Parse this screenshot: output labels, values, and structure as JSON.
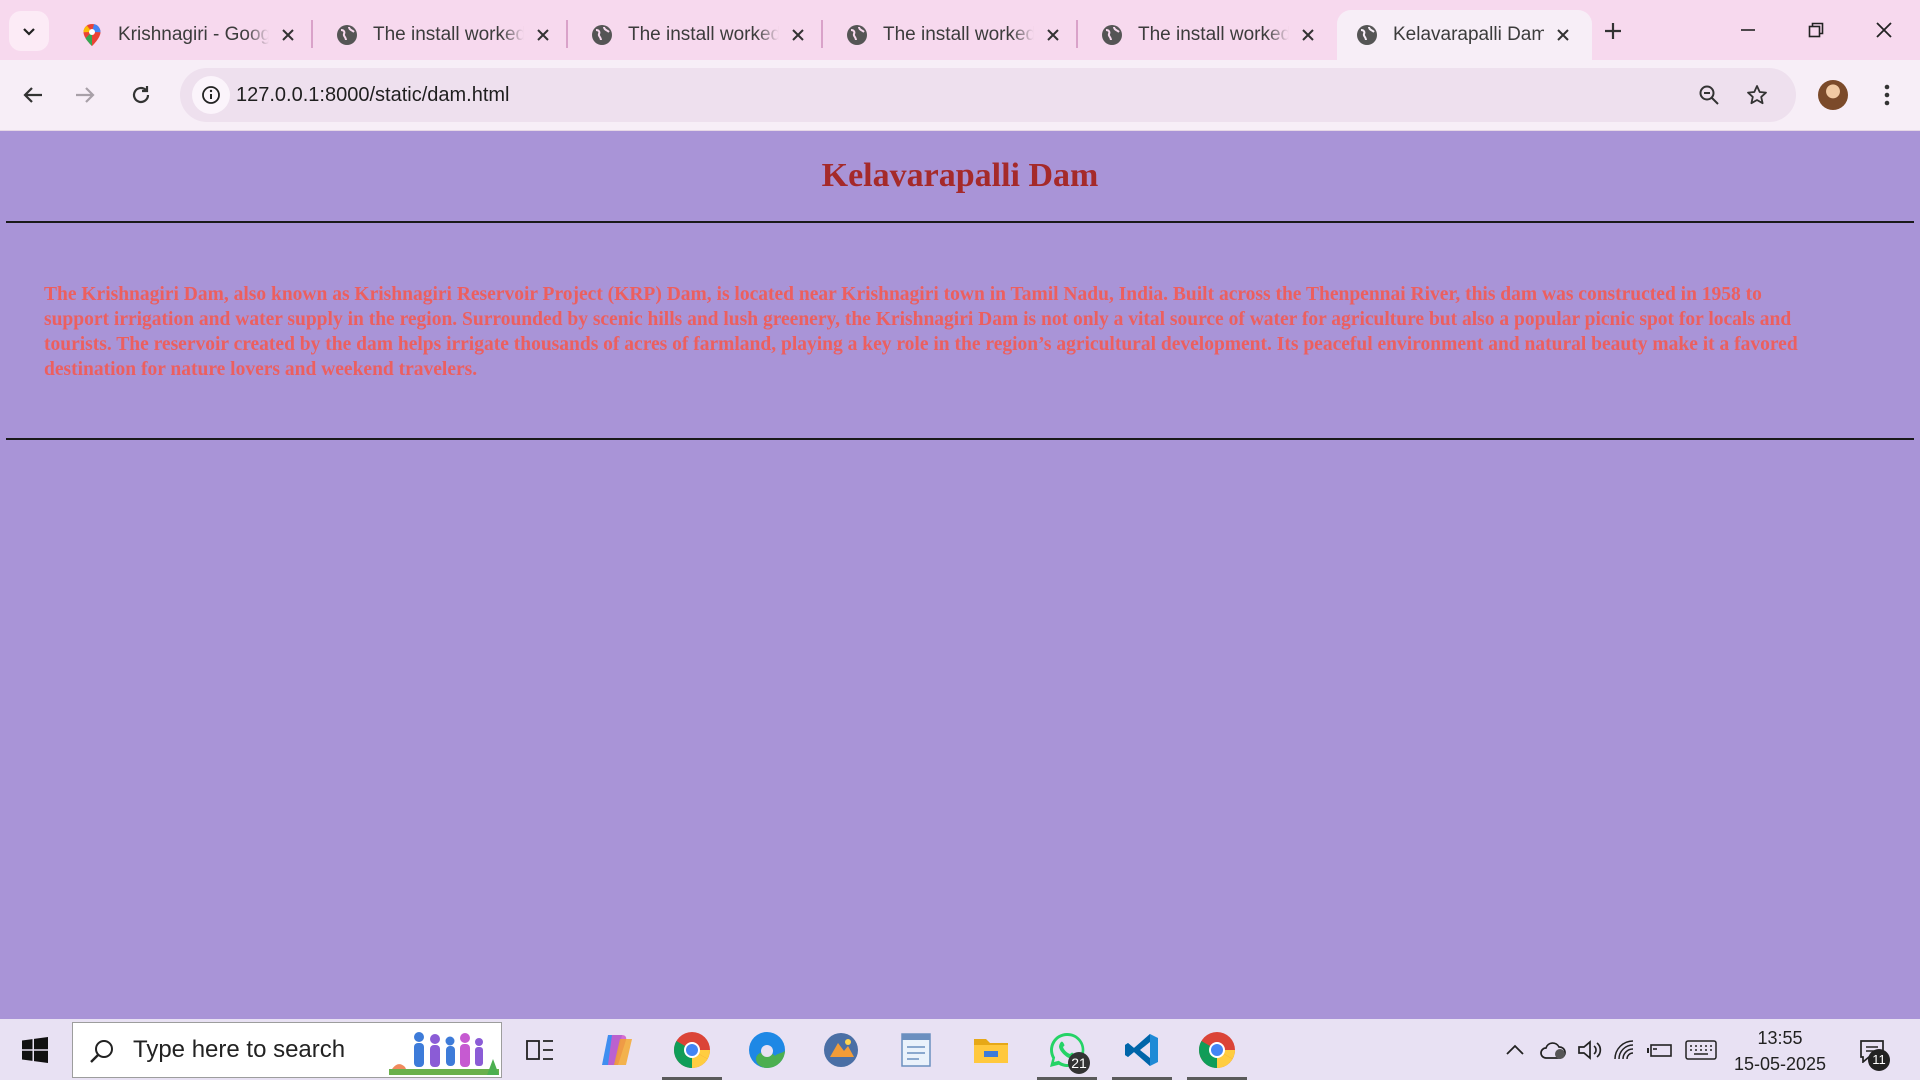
{
  "browser": {
    "tabs": [
      {
        "title": "Krishnagiri - Google Maps",
        "icon": "google-maps-icon",
        "active": false
      },
      {
        "title": "The install worked successfully!",
        "icon": "globe-icon",
        "active": false
      },
      {
        "title": "The install worked successfully!",
        "icon": "globe-icon",
        "active": false
      },
      {
        "title": "The install worked successfully!",
        "icon": "globe-icon",
        "active": false
      },
      {
        "title": "The install worked successfully!",
        "icon": "globe-icon",
        "active": false
      },
      {
        "title": "Kelavarapalli Dam",
        "icon": "globe-icon",
        "active": true
      }
    ],
    "url": "127.0.0.1:8000/static/dam.html"
  },
  "page": {
    "heading": "Kelavarapalli Dam",
    "paragraph": "The Krishnagiri Dam, also known as Krishnagiri Reservoir Project (KRP) Dam, is located near Krishnagiri town in Tamil Nadu, India. Built across the Thenpennai River, this dam was constructed in 1958 to support irrigation and water supply in the region. Surrounded by scenic hills and lush greenery, the Krishnagiri Dam is not only a vital source of water for agriculture but also a popular picnic spot for locals and tourists. The reservoir created by the dam helps irrigate thousands of acres of farmland, playing a key role in the region’s agricultural development. Its peaceful environment and natural beauty make it a favored destination for nature lovers and weekend travelers.",
    "background": "#a994d7",
    "heading_color": "#a52a2a",
    "text_color": "#ec5f5f"
  },
  "taskbar": {
    "search_placeholder": "Type here to search",
    "apps": [
      {
        "name": "task-view",
        "running": false
      },
      {
        "name": "copilot",
        "running": false
      },
      {
        "name": "chrome",
        "running": true
      },
      {
        "name": "edge",
        "running": false
      },
      {
        "name": "media-app",
        "running": false
      },
      {
        "name": "notepad-app",
        "running": false
      },
      {
        "name": "file-explorer",
        "running": false
      },
      {
        "name": "whatsapp",
        "running": true,
        "badge": "21"
      },
      {
        "name": "vscode",
        "running": true
      },
      {
        "name": "chrome-2",
        "running": true
      }
    ],
    "time": "13:55",
    "date": "15-05-2025",
    "notification_count": "11"
  }
}
